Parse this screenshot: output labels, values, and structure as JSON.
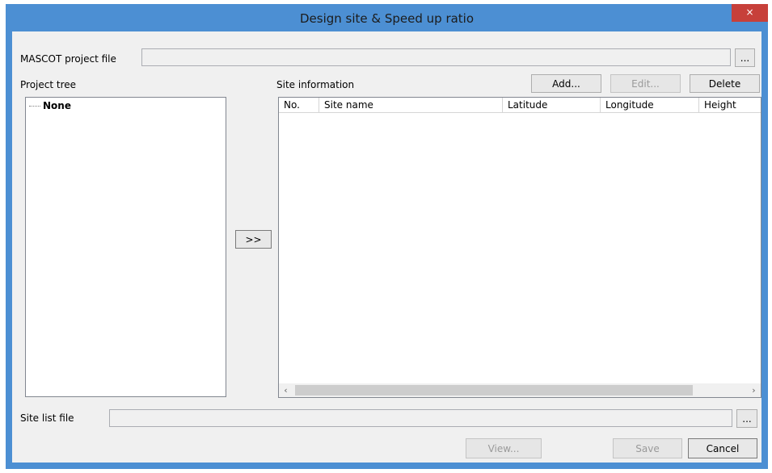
{
  "window": {
    "title": "Design site & Speed up ratio",
    "close_glyph": "×"
  },
  "mascot": {
    "label": "MASCOT project file",
    "value": "",
    "browse_label": "..."
  },
  "project_tree": {
    "label": "Project tree",
    "items": [
      "None"
    ]
  },
  "transfer_label": ">>",
  "site_info": {
    "label": "Site information",
    "add_label": "Add...",
    "edit_label": "Edit...",
    "delete_label": "Delete",
    "columns": [
      "No.",
      "Site name",
      "Latitude",
      "Longitude",
      "Height"
    ],
    "rows": []
  },
  "scrollbar": {
    "left_glyph": "‹",
    "right_glyph": "›"
  },
  "site_list": {
    "label": "Site list file",
    "value": "",
    "browse_label": "..."
  },
  "footer": {
    "view_label": "View...",
    "save_label": "Save",
    "cancel_label": "Cancel"
  }
}
